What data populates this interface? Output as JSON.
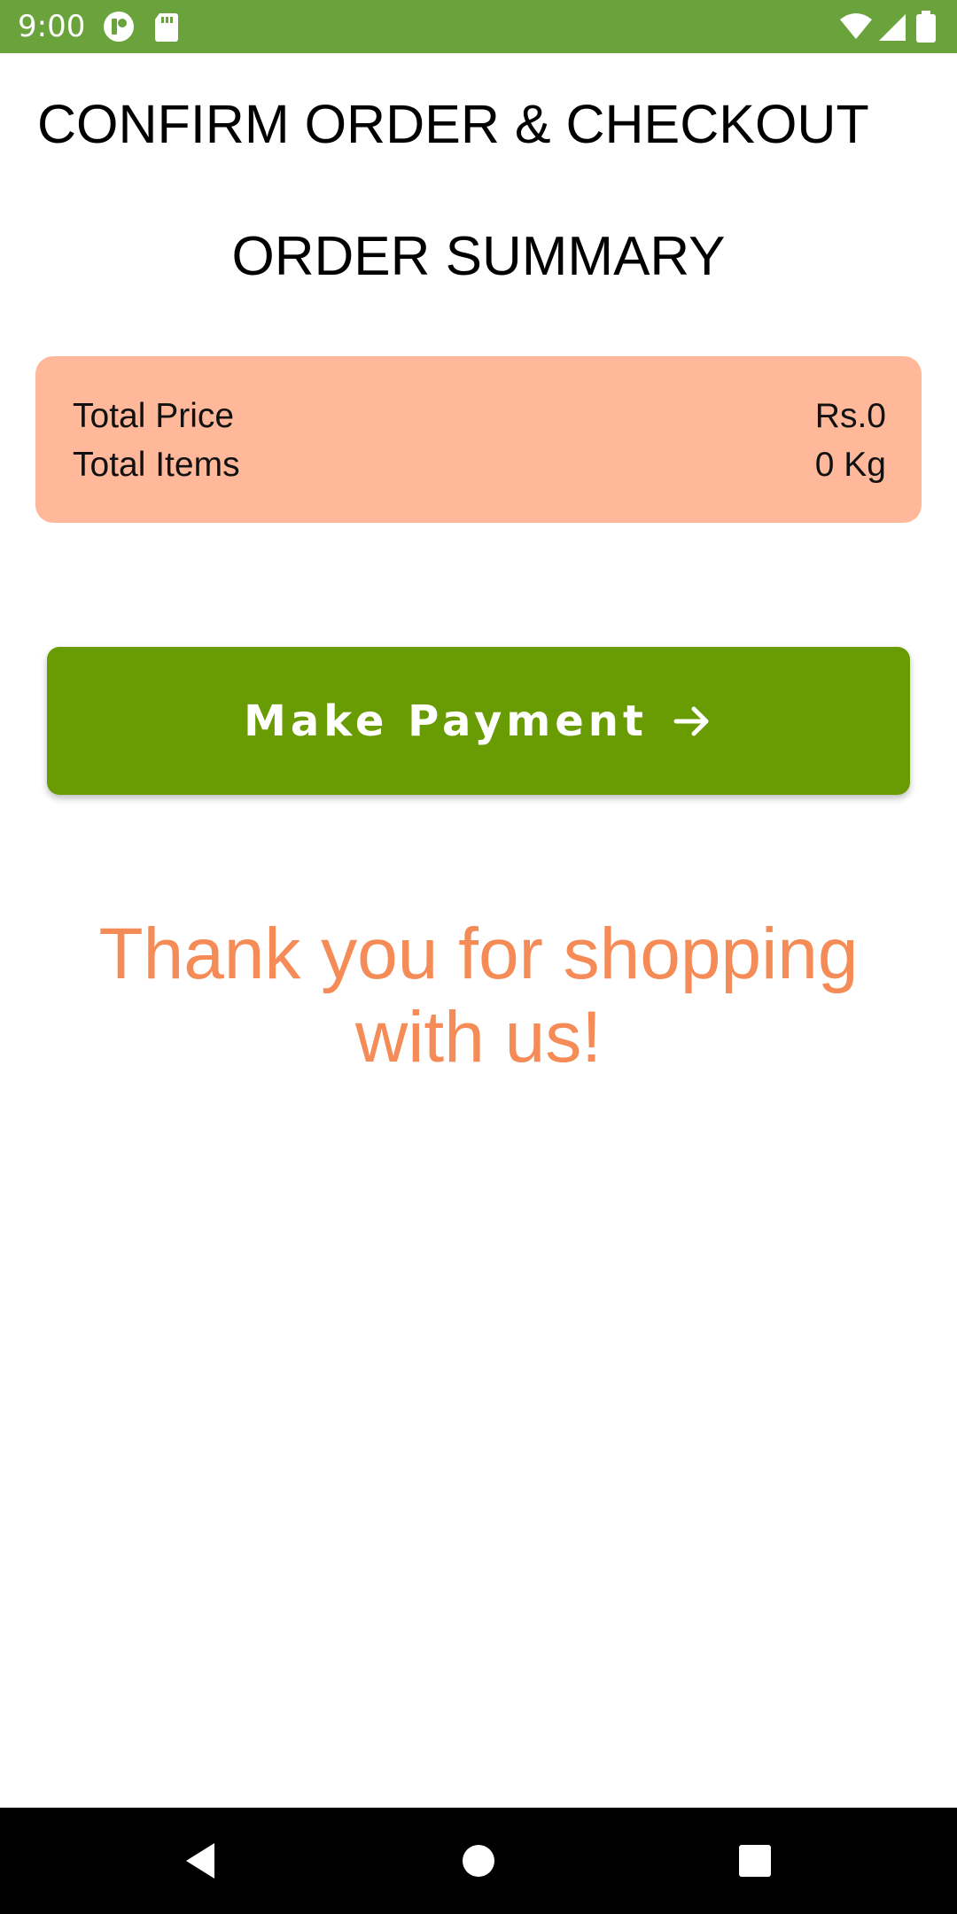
{
  "status_bar": {
    "time": "9:00",
    "background": "#6aa23c",
    "icons": [
      "app-notification-icon",
      "sd-card-icon",
      "wifi-icon",
      "signal-icon",
      "battery-icon"
    ]
  },
  "header": {
    "title": "CONFIRM ORDER & CHECKOUT"
  },
  "summary": {
    "title": "ORDER SUMMARY",
    "card_color": "#ffb89a",
    "rows": [
      {
        "label": "Total Price",
        "value": "Rs.0"
      },
      {
        "label": "Total Items",
        "value": "0 Kg"
      }
    ]
  },
  "payment_button": {
    "label": "Make Payment",
    "icon": "arrow-right-icon",
    "color": "#699c03"
  },
  "thank_you": {
    "text": "Thank you for shopping with us!",
    "color": "#f58b56"
  },
  "nav_bar": {
    "icons": [
      "back-icon",
      "home-icon",
      "recents-icon"
    ]
  }
}
